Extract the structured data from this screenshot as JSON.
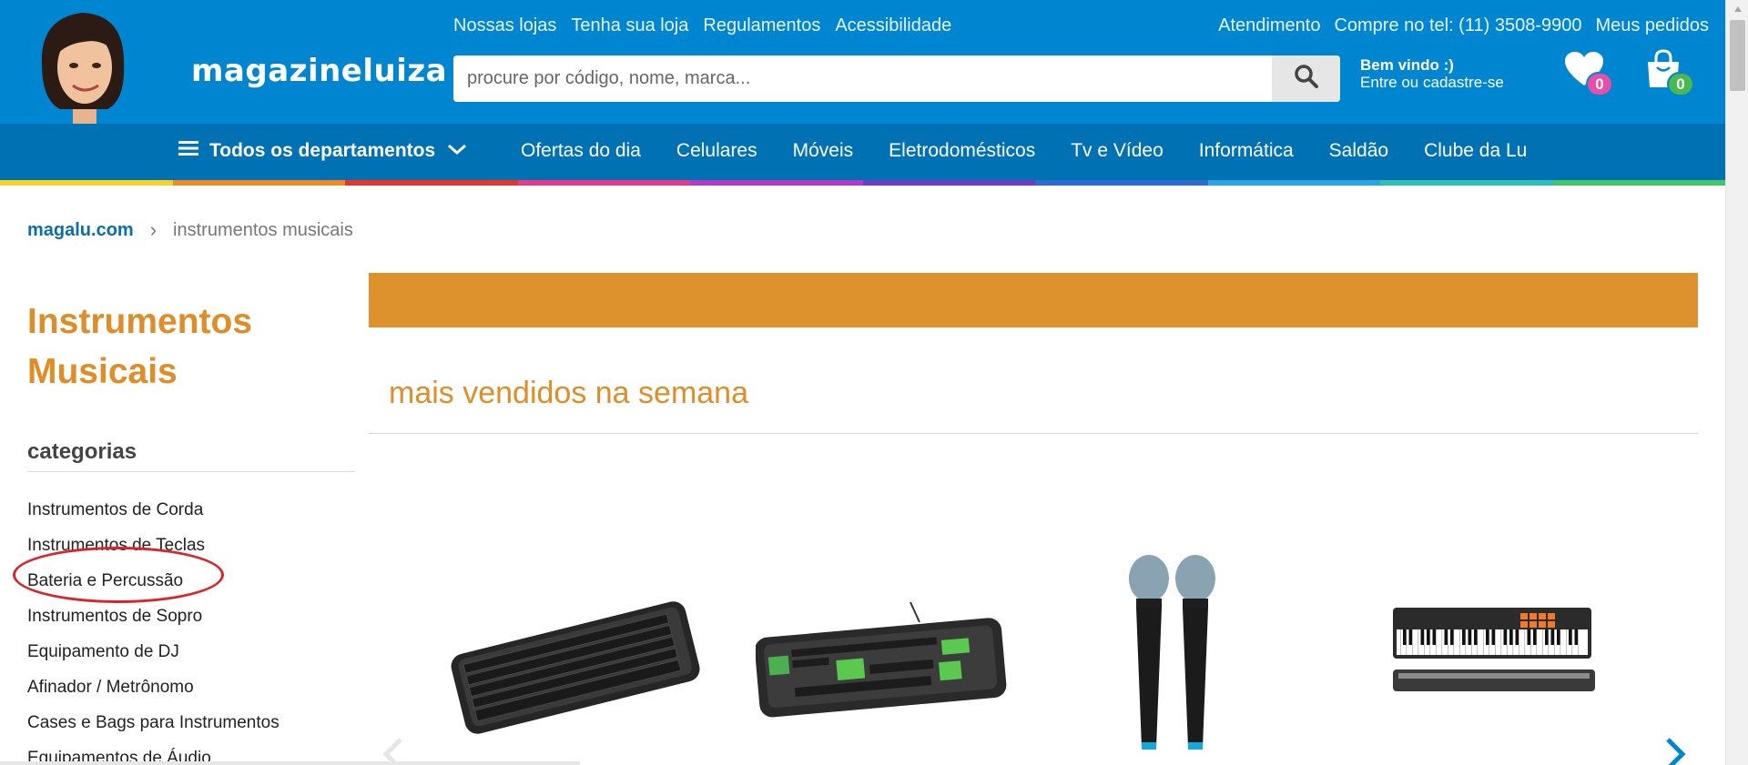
{
  "header": {
    "logo": "magazineluiza",
    "top_links": [
      "Nossas lojas",
      "Tenha sua loja",
      "Regulamentos",
      "Acessibilidade"
    ],
    "service": "Atendimento",
    "phone": "Compre no tel: (11) 3508-9900",
    "orders": "Meus pedidos",
    "search_placeholder": "procure por código, nome, marca...",
    "welcome_title": "Bem vindo :)",
    "welcome_sub": "Entre ou cadastre-se",
    "wishlist_count": "0",
    "cart_count": "0"
  },
  "nav": {
    "all_departments": "Todos os departamentos",
    "items": [
      "Ofertas do dia",
      "Celulares",
      "Móveis",
      "Eletrodomésticos",
      "Tv e Vídeo",
      "Informática",
      "Saldão",
      "Clube da Lu"
    ]
  },
  "colors": {
    "header_blue": "#0086d1",
    "nav_blue": "#0071b3",
    "accent_orange": "#de8d29",
    "highlight_red": "#d9232d",
    "rainbow": [
      "#f5d329",
      "#f08a24",
      "#e4362f",
      "#e43a8c",
      "#b13cc8",
      "#6d3dc9",
      "#2f6ad0",
      "#2aa5e1",
      "#2fc0b3",
      "#42c86b"
    ]
  },
  "breadcrumb": {
    "home": "magalu.com",
    "current": "instrumentos musicais"
  },
  "sidebar": {
    "title": "Instrumentos Musicais",
    "categories_heading": "categorias",
    "categories": [
      "Instrumentos de Corda",
      "Instrumentos de Teclas",
      "Bateria e Percussão",
      "Instrumentos de Sopro",
      "Equipamento de DJ",
      "Afinador / Metrônomo",
      "Cases e Bags para Instrumentos",
      "Equipamentos de Áudio"
    ],
    "highlighted_category": "Bateria e Percussão"
  },
  "main": {
    "section_title": "mais vendidos na semana",
    "products": [
      "keyboard-black",
      "keyboard-gamer-green",
      "wireless-microphones",
      "midi-keyboard-m-audio"
    ]
  }
}
